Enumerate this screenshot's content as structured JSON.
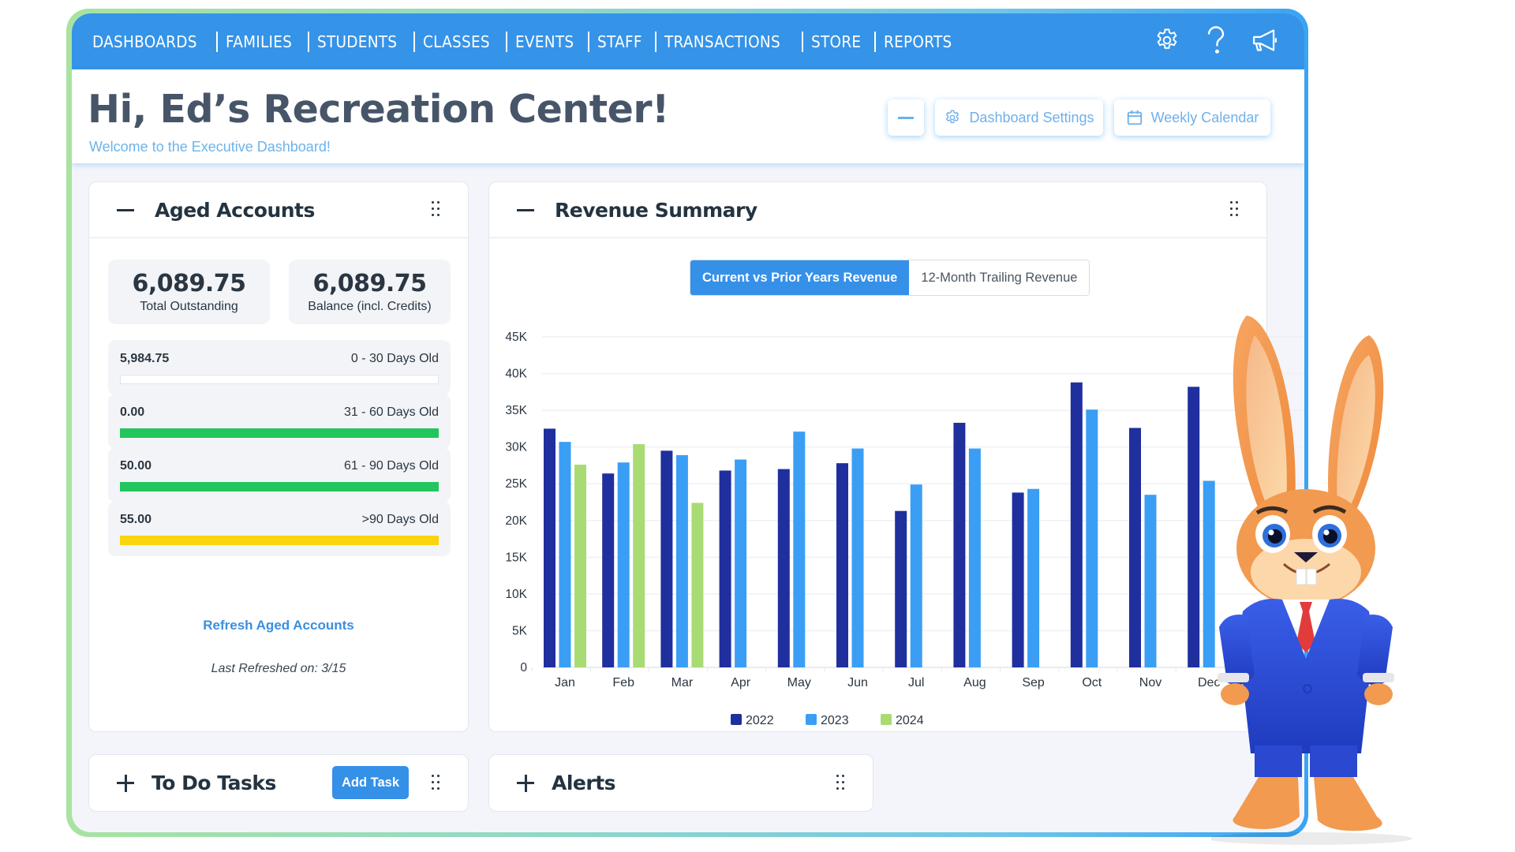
{
  "nav": {
    "items": [
      "DASHBOARDS",
      "FAMILIES",
      "STUDENTS",
      "CLASSES",
      "EVENTS",
      "STAFF",
      "TRANSACTIONS",
      "STORE",
      "REPORTS"
    ],
    "icons": [
      "gear-icon",
      "help-icon",
      "megaphone-icon"
    ]
  },
  "header": {
    "title": "Hi, Ed’s Recreation Center!",
    "subtitle": "Welcome to the Executive Dashboard!",
    "collapse_label": "—",
    "dashboard_settings_label": "Dashboard Settings",
    "weekly_calendar_label": "Weekly Calendar"
  },
  "aged_accounts": {
    "title": "Aged Accounts",
    "total_outstanding": {
      "value": "6,089.75",
      "label": "Total Outstanding"
    },
    "balance": {
      "value": "6,089.75",
      "label": "Balance (incl. Credits)"
    },
    "buckets": [
      {
        "amount": "5,984.75",
        "label": "0 - 30 Days Old",
        "fill": 0,
        "color": "#ffffff"
      },
      {
        "amount": "0.00",
        "label": "31 - 60 Days Old",
        "fill": 100,
        "color": "#22c55e"
      },
      {
        "amount": "50.00",
        "label": "61 - 90 Days Old",
        "fill": 100,
        "color": "#22c55e"
      },
      {
        "amount": "55.00",
        "label": ">90 Days Old",
        "fill": 100,
        "color": "#fad40c"
      }
    ],
    "refresh_label": "Refresh Aged Accounts",
    "last_refreshed": "Last Refreshed on: 3/15"
  },
  "revenue": {
    "title": "Revenue Summary",
    "tabs": [
      {
        "label": "Current vs Prior Years Revenue",
        "active": true
      },
      {
        "label": "12-Month Trailing Revenue",
        "active": false
      }
    ]
  },
  "todo": {
    "title": "To Do Tasks",
    "add_label": "Add Task"
  },
  "alerts": {
    "title": "Alerts"
  },
  "chart_data": {
    "type": "bar",
    "title": "Current vs Prior Years Revenue",
    "xlabel": "",
    "ylabel": "",
    "categories": [
      "Jan",
      "Feb",
      "Mar",
      "Apr",
      "May",
      "Jun",
      "Jul",
      "Aug",
      "Sep",
      "Oct",
      "Nov",
      "Dec"
    ],
    "series": [
      {
        "name": "2022",
        "color": "#1f2f9e",
        "values": [
          32500,
          26400,
          29500,
          26800,
          27000,
          27800,
          21300,
          33300,
          23800,
          38800,
          32600,
          38200
        ]
      },
      {
        "name": "2023",
        "color": "#3a9ef5",
        "values": [
          30700,
          27900,
          28900,
          28300,
          32100,
          29800,
          24900,
          29800,
          24300,
          35100,
          23500,
          25400
        ]
      },
      {
        "name": "2024",
        "color": "#a9db74",
        "values": [
          27600,
          30400,
          22400,
          null,
          null,
          null,
          null,
          null,
          null,
          null,
          null,
          null
        ]
      }
    ],
    "yticks": [
      "0",
      "5K",
      "10K",
      "15K",
      "20K",
      "25K",
      "30K",
      "35K",
      "40K",
      "45K"
    ],
    "ylim": [
      0,
      45000
    ],
    "grid": true,
    "legend": "bottom-center"
  }
}
